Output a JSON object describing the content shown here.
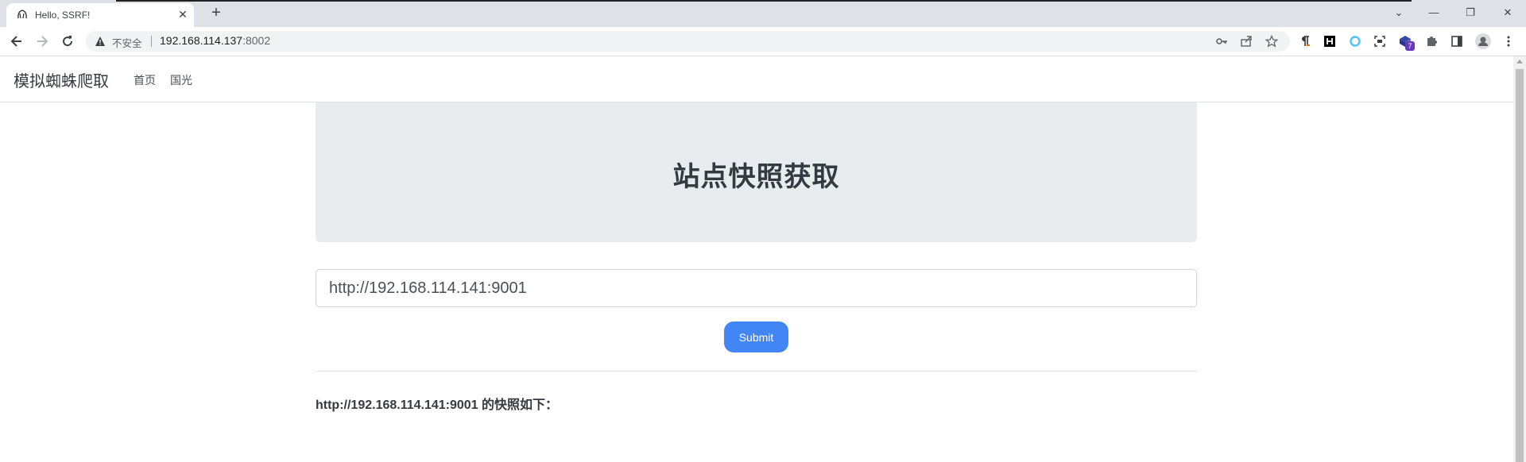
{
  "browser": {
    "tab_title": "Hello, SSRF!",
    "tab_close": "✕",
    "new_tab": "+",
    "window_controls": [
      "⌄",
      "—",
      "❐",
      "✕"
    ],
    "security_label": "不安全",
    "url_host": "192.168.114.137",
    "url_port": ":8002",
    "extension_badge": "7"
  },
  "navbar": {
    "brand": "模拟蜘蛛爬取",
    "links": [
      "首页",
      "国光"
    ]
  },
  "jumbotron": {
    "title": "站点快照获取"
  },
  "form": {
    "url_value": "http://192.168.114.141:9001",
    "submit_label": "Submit"
  },
  "result": {
    "text": "http://192.168.114.141:9001 的快照如下："
  }
}
